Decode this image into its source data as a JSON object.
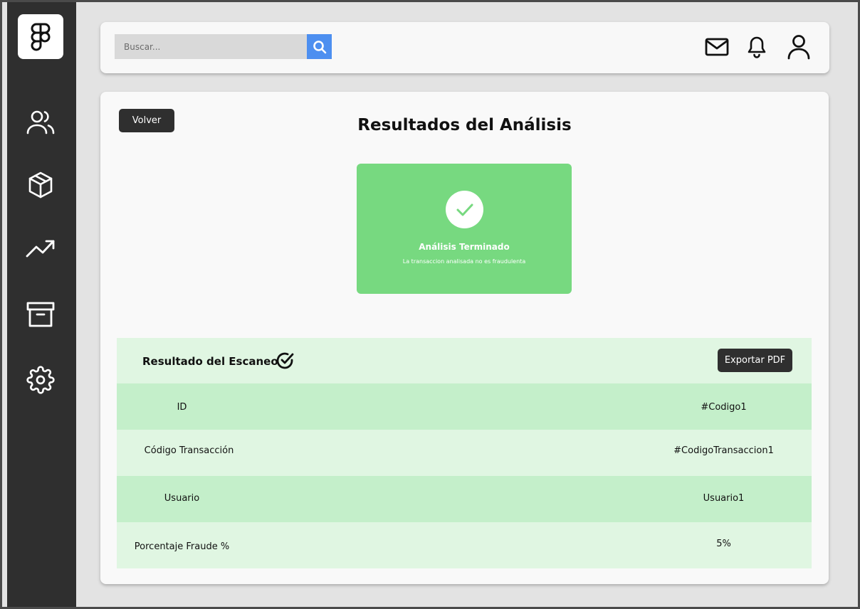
{
  "sidebar": {
    "logo_icon": "figma-icon",
    "items": [
      {
        "icon": "users-icon"
      },
      {
        "icon": "box-icon"
      },
      {
        "icon": "trending-up-icon"
      },
      {
        "icon": "archive-icon"
      },
      {
        "icon": "gear-icon"
      }
    ]
  },
  "topbar": {
    "search_placeholder": "Buscar...",
    "search_icon": "search-icon",
    "icons": [
      "mail-icon",
      "bell-icon",
      "user-icon"
    ]
  },
  "main": {
    "back_label": "Volver",
    "title": "Resultados del Análisis",
    "status_card": {
      "title": "Análisis Terminado",
      "subtitle": "La transaccion analisada no es fraudulenta",
      "color": "#77d980"
    },
    "results": {
      "title": "Resultado del Escaneo",
      "export_label": "Exportar PDF",
      "rows": [
        {
          "label": "ID",
          "value": "#Codigo1"
        },
        {
          "label": "Código Transacción",
          "value": "#CodigoTransaccion1"
        },
        {
          "label": "Usuario",
          "value": "Usuario1"
        },
        {
          "label": "Porcentaje Fraude %",
          "value": "5%"
        }
      ]
    }
  },
  "colors": {
    "sidebar": "#2f2f2f",
    "accent": "#4d8ff0",
    "success": "#77d980",
    "row_dark": "#c4efca",
    "row_light": "#e0f6e2"
  }
}
